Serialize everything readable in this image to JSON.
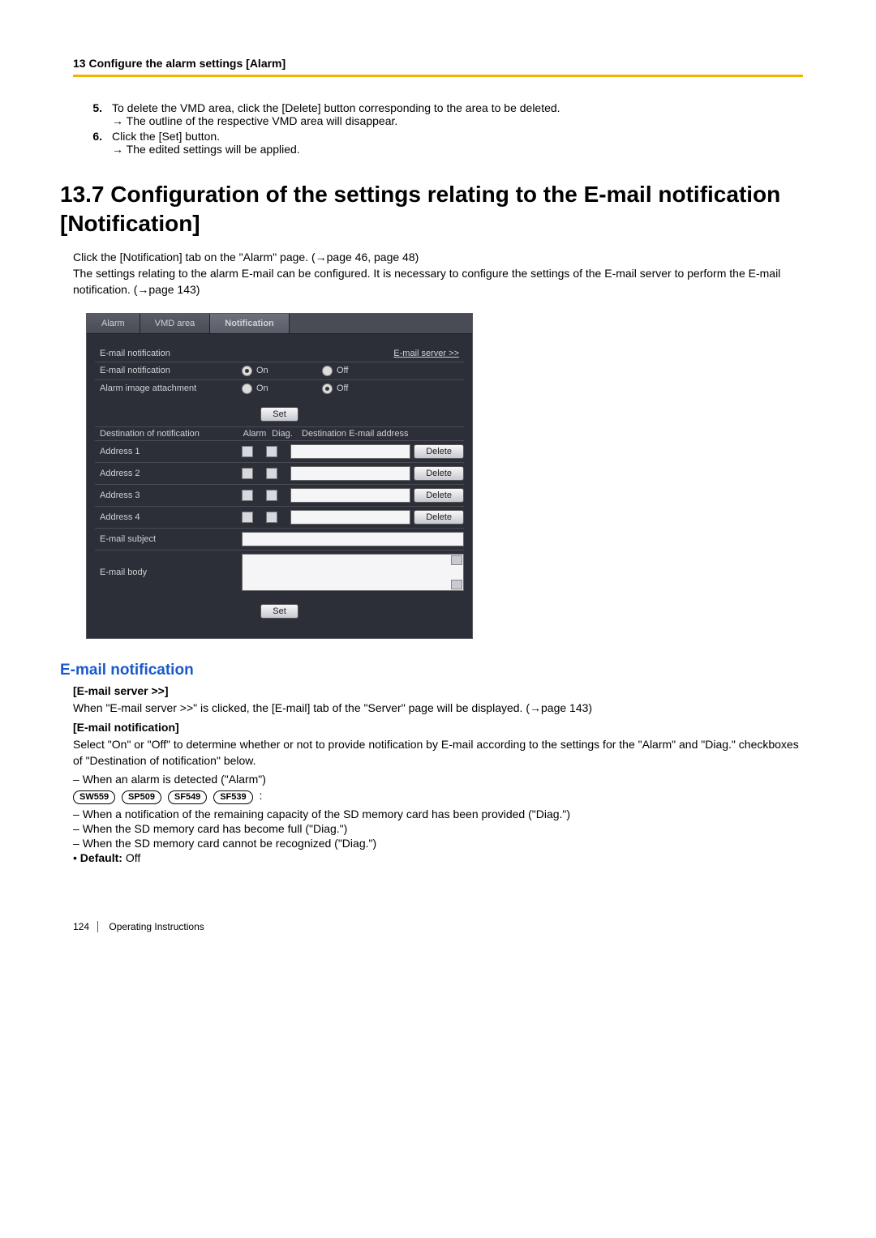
{
  "header": {
    "chapter": "13 Configure the alarm settings [Alarm]"
  },
  "steps": {
    "s5": {
      "num": "5.",
      "text": "To delete the VMD area, click the [Delete] button corresponding to the area to be deleted.",
      "result": "The outline of the respective VMD area will disappear."
    },
    "s6": {
      "num": "6.",
      "text": "Click the [Set] button.",
      "result": "The edited settings will be applied."
    }
  },
  "section_title": "13.7  Configuration of the settings relating to the E-mail notification [Notification]",
  "intro_1": "Click the [Notification] tab on the \"Alarm\" page. (→page 46, page 48)",
  "intro_2": "The settings relating to the alarm E-mail can be configured. It is necessary to configure the settings of the E-mail server to perform the E-mail notification. (→page 143)",
  "ui": {
    "tabs": {
      "alarm": "Alarm",
      "vmd": "VMD area",
      "notification": "Notification"
    },
    "group_email_notif": "E-mail notification",
    "link_email_server": "E-mail server >>",
    "row_email_notif": "E-mail notification",
    "row_alarm_img": "Alarm image attachment",
    "on": "On",
    "off": "Off",
    "set": "Set",
    "group_dest": "Destination of notification",
    "col_alarm": "Alarm",
    "col_diag": "Diag.",
    "col_dest": "Destination E-mail address",
    "addr1": "Address 1",
    "addr2": "Address 2",
    "addr3": "Address 3",
    "addr4": "Address 4",
    "delete": "Delete",
    "email_subject": "E-mail subject",
    "email_body": "E-mail body"
  },
  "heading_email": "E-mail notification",
  "email_server": {
    "title": "[E-mail server >>]",
    "body": "When \"E-mail server >>\" is clicked, the [E-mail] tab of the \"Server\" page will be displayed. (→page 143)"
  },
  "email_notif": {
    "title": "[E-mail notification]",
    "body": "Select \"On\" or \"Off\" to determine whether or not to provide notification by E-mail according to the settings for the \"Alarm\" and \"Diag.\" checkboxes of \"Destination of notification\" below.",
    "l_alarm": "When an alarm is detected (\"Alarm\")",
    "models": [
      "SW559",
      "SP509",
      "SF549",
      "SF539"
    ],
    "l_diag1": "When a notification of the remaining capacity of the SD memory card has been provided (\"Diag.\")",
    "l_diag2": "When the SD memory card has become full (\"Diag.\")",
    "l_diag3": "When the SD memory card cannot be recognized (\"Diag.\")",
    "default_label": "Default:",
    "default_value": "Off"
  },
  "footer": {
    "page": "124",
    "doc": "Operating Instructions"
  }
}
